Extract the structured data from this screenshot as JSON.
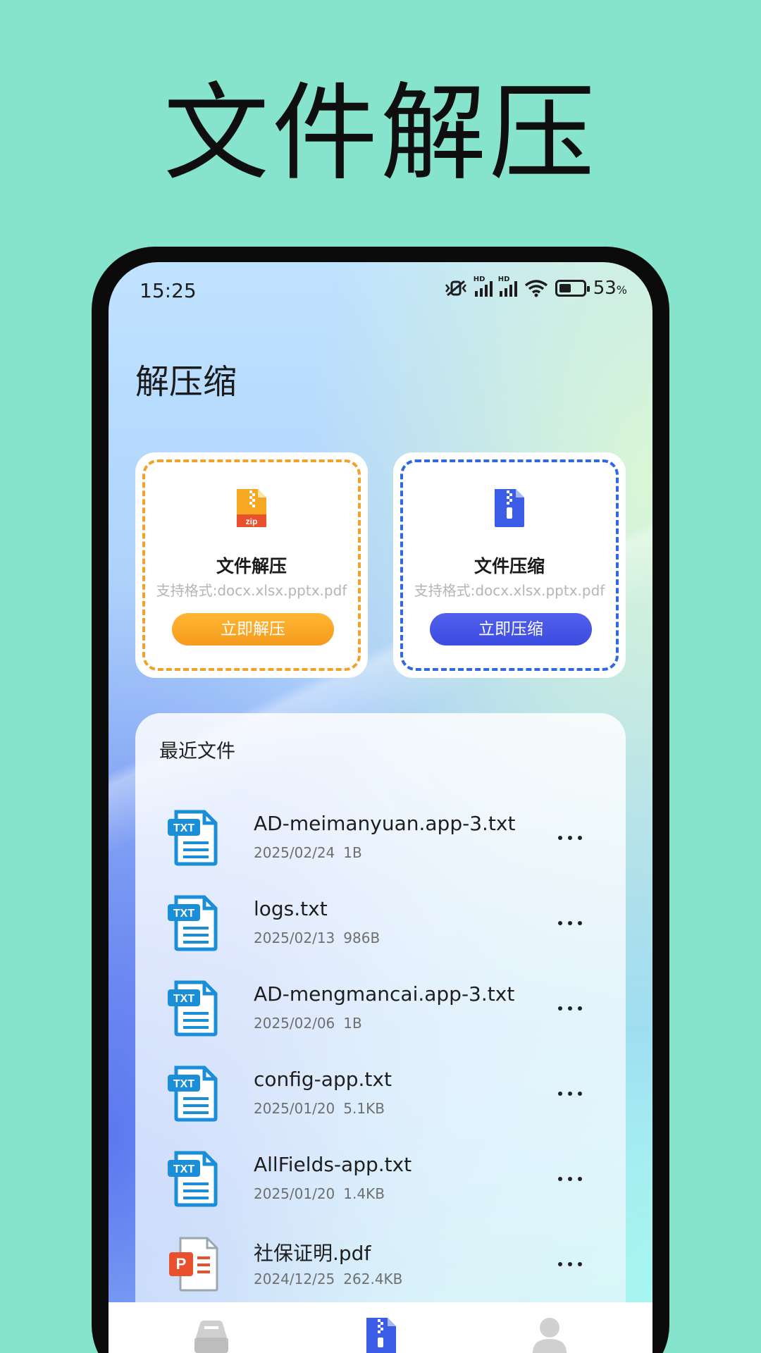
{
  "hero": {
    "title": "文件解压"
  },
  "status_bar": {
    "time": "15:25",
    "battery_pct": "53",
    "battery_unit": "%",
    "hd1": "HD",
    "hd2": "HD"
  },
  "page": {
    "title": "解压缩"
  },
  "cards": {
    "extract": {
      "title": "文件解压",
      "subtitle": "支持格式:docx.xlsx.pptx.pdf",
      "button": "立即解压",
      "icon": "zip-file-icon",
      "accent": "#f0a22a"
    },
    "compress": {
      "title": "文件压缩",
      "subtitle": "支持格式:docx.xlsx.pptx.pdf",
      "button": "立即压缩",
      "icon": "compress-file-icon",
      "accent": "#2f68e0"
    }
  },
  "recent": {
    "title": "最近文件",
    "files": [
      {
        "name": "AD-meimanyuan.app-3.txt",
        "date": "2025/02/24",
        "size": "1B",
        "type": "txt",
        "icon_label": "TXT"
      },
      {
        "name": "logs.txt",
        "date": "2025/02/13",
        "size": "986B",
        "type": "txt",
        "icon_label": "TXT"
      },
      {
        "name": "AD-mengmancai.app-3.txt",
        "date": "2025/02/06",
        "size": "1B",
        "type": "txt",
        "icon_label": "TXT"
      },
      {
        "name": "config-app.txt",
        "date": "2025/01/20",
        "size": "5.1KB",
        "type": "txt",
        "icon_label": "TXT"
      },
      {
        "name": "AllFields-app.txt",
        "date": "2025/01/20",
        "size": "1.4KB",
        "type": "txt",
        "icon_label": "TXT"
      },
      {
        "name": "社保证明.pdf",
        "date": "2024/12/25",
        "size": "262.4KB",
        "type": "ppt",
        "icon_label": "P"
      }
    ]
  },
  "colors": {
    "background": "#86e3cc",
    "txt_icon": "#1a8fd8",
    "ppt_icon": "#e8502e"
  },
  "icon_labels": {
    "zip": "zip"
  },
  "nav": {
    "items": [
      {
        "id": "files",
        "icon": "file-box-icon"
      },
      {
        "id": "compress",
        "icon": "zip-file-icon",
        "active": true
      },
      {
        "id": "profile",
        "icon": "user-icon"
      }
    ]
  }
}
